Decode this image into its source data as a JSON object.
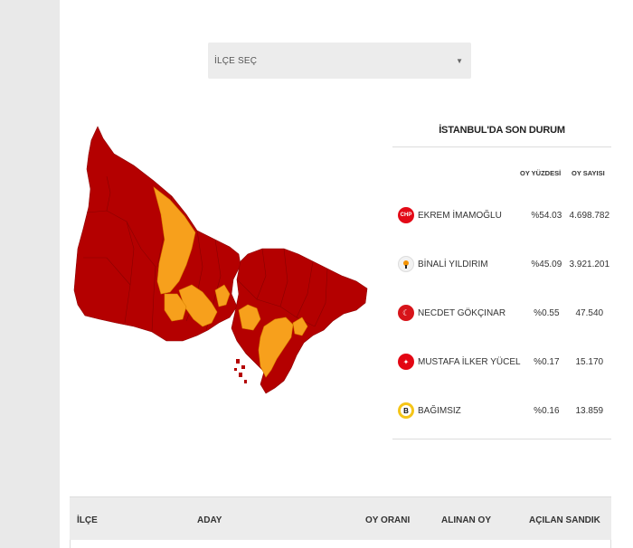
{
  "district_select": {
    "label": "İLÇE SEÇ",
    "arrow_icon": "dropdown-arrow-icon"
  },
  "map": {
    "winner_colors": {
      "chp": "#b40000",
      "akp": "#f7a01c"
    }
  },
  "results": {
    "title": "İSTANBUL'DA SON DURUM",
    "headers": {
      "percent": "OY YÜZDESİ",
      "votes": "OY SAYISI"
    },
    "candidates": [
      {
        "name": "EKREM İMAMOĞLU",
        "percent": "%54.03",
        "votes": "4.698.782",
        "logo": "chp-logo",
        "logo_text": "CHP",
        "color": "#e30a17"
      },
      {
        "name": "BİNALİ YILDIRIM",
        "percent": "%45.09",
        "votes": "3.921.201",
        "logo": "akp-logo",
        "logo_text": "",
        "color": "#f39200"
      },
      {
        "name": "NECDET GÖKÇINAR",
        "percent": "%0.55",
        "votes": "47.540",
        "logo": "saadet-logo",
        "logo_text": "",
        "color": "#d7141a"
      },
      {
        "name": "MUSTAFA İLKER YÜCEL",
        "percent": "%0.17",
        "votes": "15.170",
        "logo": "vatan-logo",
        "logo_text": "",
        "color": "#e30613"
      },
      {
        "name": "BAĞIMSIZ",
        "percent": "%0.16",
        "votes": "13.859",
        "logo": "independent-logo",
        "logo_text": "B",
        "color": "#f5c518"
      }
    ]
  },
  "table": {
    "headers": {
      "district": "İLÇE",
      "candidate": "ADAY",
      "vote_rate": "OY ORANI",
      "votes_received": "ALINAN OY",
      "opened_boxes": "AÇILAN SANDIK"
    }
  }
}
